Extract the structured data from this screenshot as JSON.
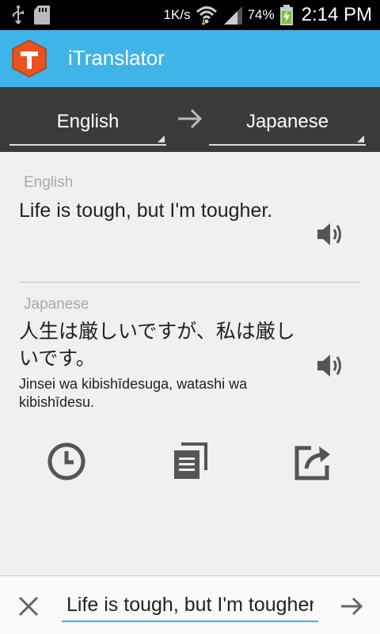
{
  "status_bar": {
    "data_rate": "1K/s",
    "battery": "74%",
    "time": "2:14 PM",
    "icons": [
      "usb-icon",
      "sd-card-icon",
      "wifi-icon",
      "signal-icon",
      "battery-charging-icon"
    ]
  },
  "app_bar": {
    "title": "iTranslator",
    "logo_letter": "T",
    "logo_color": "#e8531e"
  },
  "language_bar": {
    "source_language": "English",
    "target_language": "Japanese",
    "swap_icon": "arrow-right-icon"
  },
  "translation": {
    "source_label": "English",
    "source_text": "Life is tough, but I'm tougher.",
    "target_label": "Japanese",
    "target_text": "人生は厳しいですが、私は厳しいです。",
    "target_romanization": "Jinsei wa kibishīdesuga, watashi wa kibishīdesu."
  },
  "actions": [
    "history-icon",
    "copy-icon",
    "share-icon"
  ],
  "input_bar": {
    "value": "Life is tough, but I'm tougher."
  },
  "colors": {
    "app_bar": "#3fb4e8",
    "language_bar": "#3b3b3b",
    "input_underline": "#33b5e5"
  }
}
